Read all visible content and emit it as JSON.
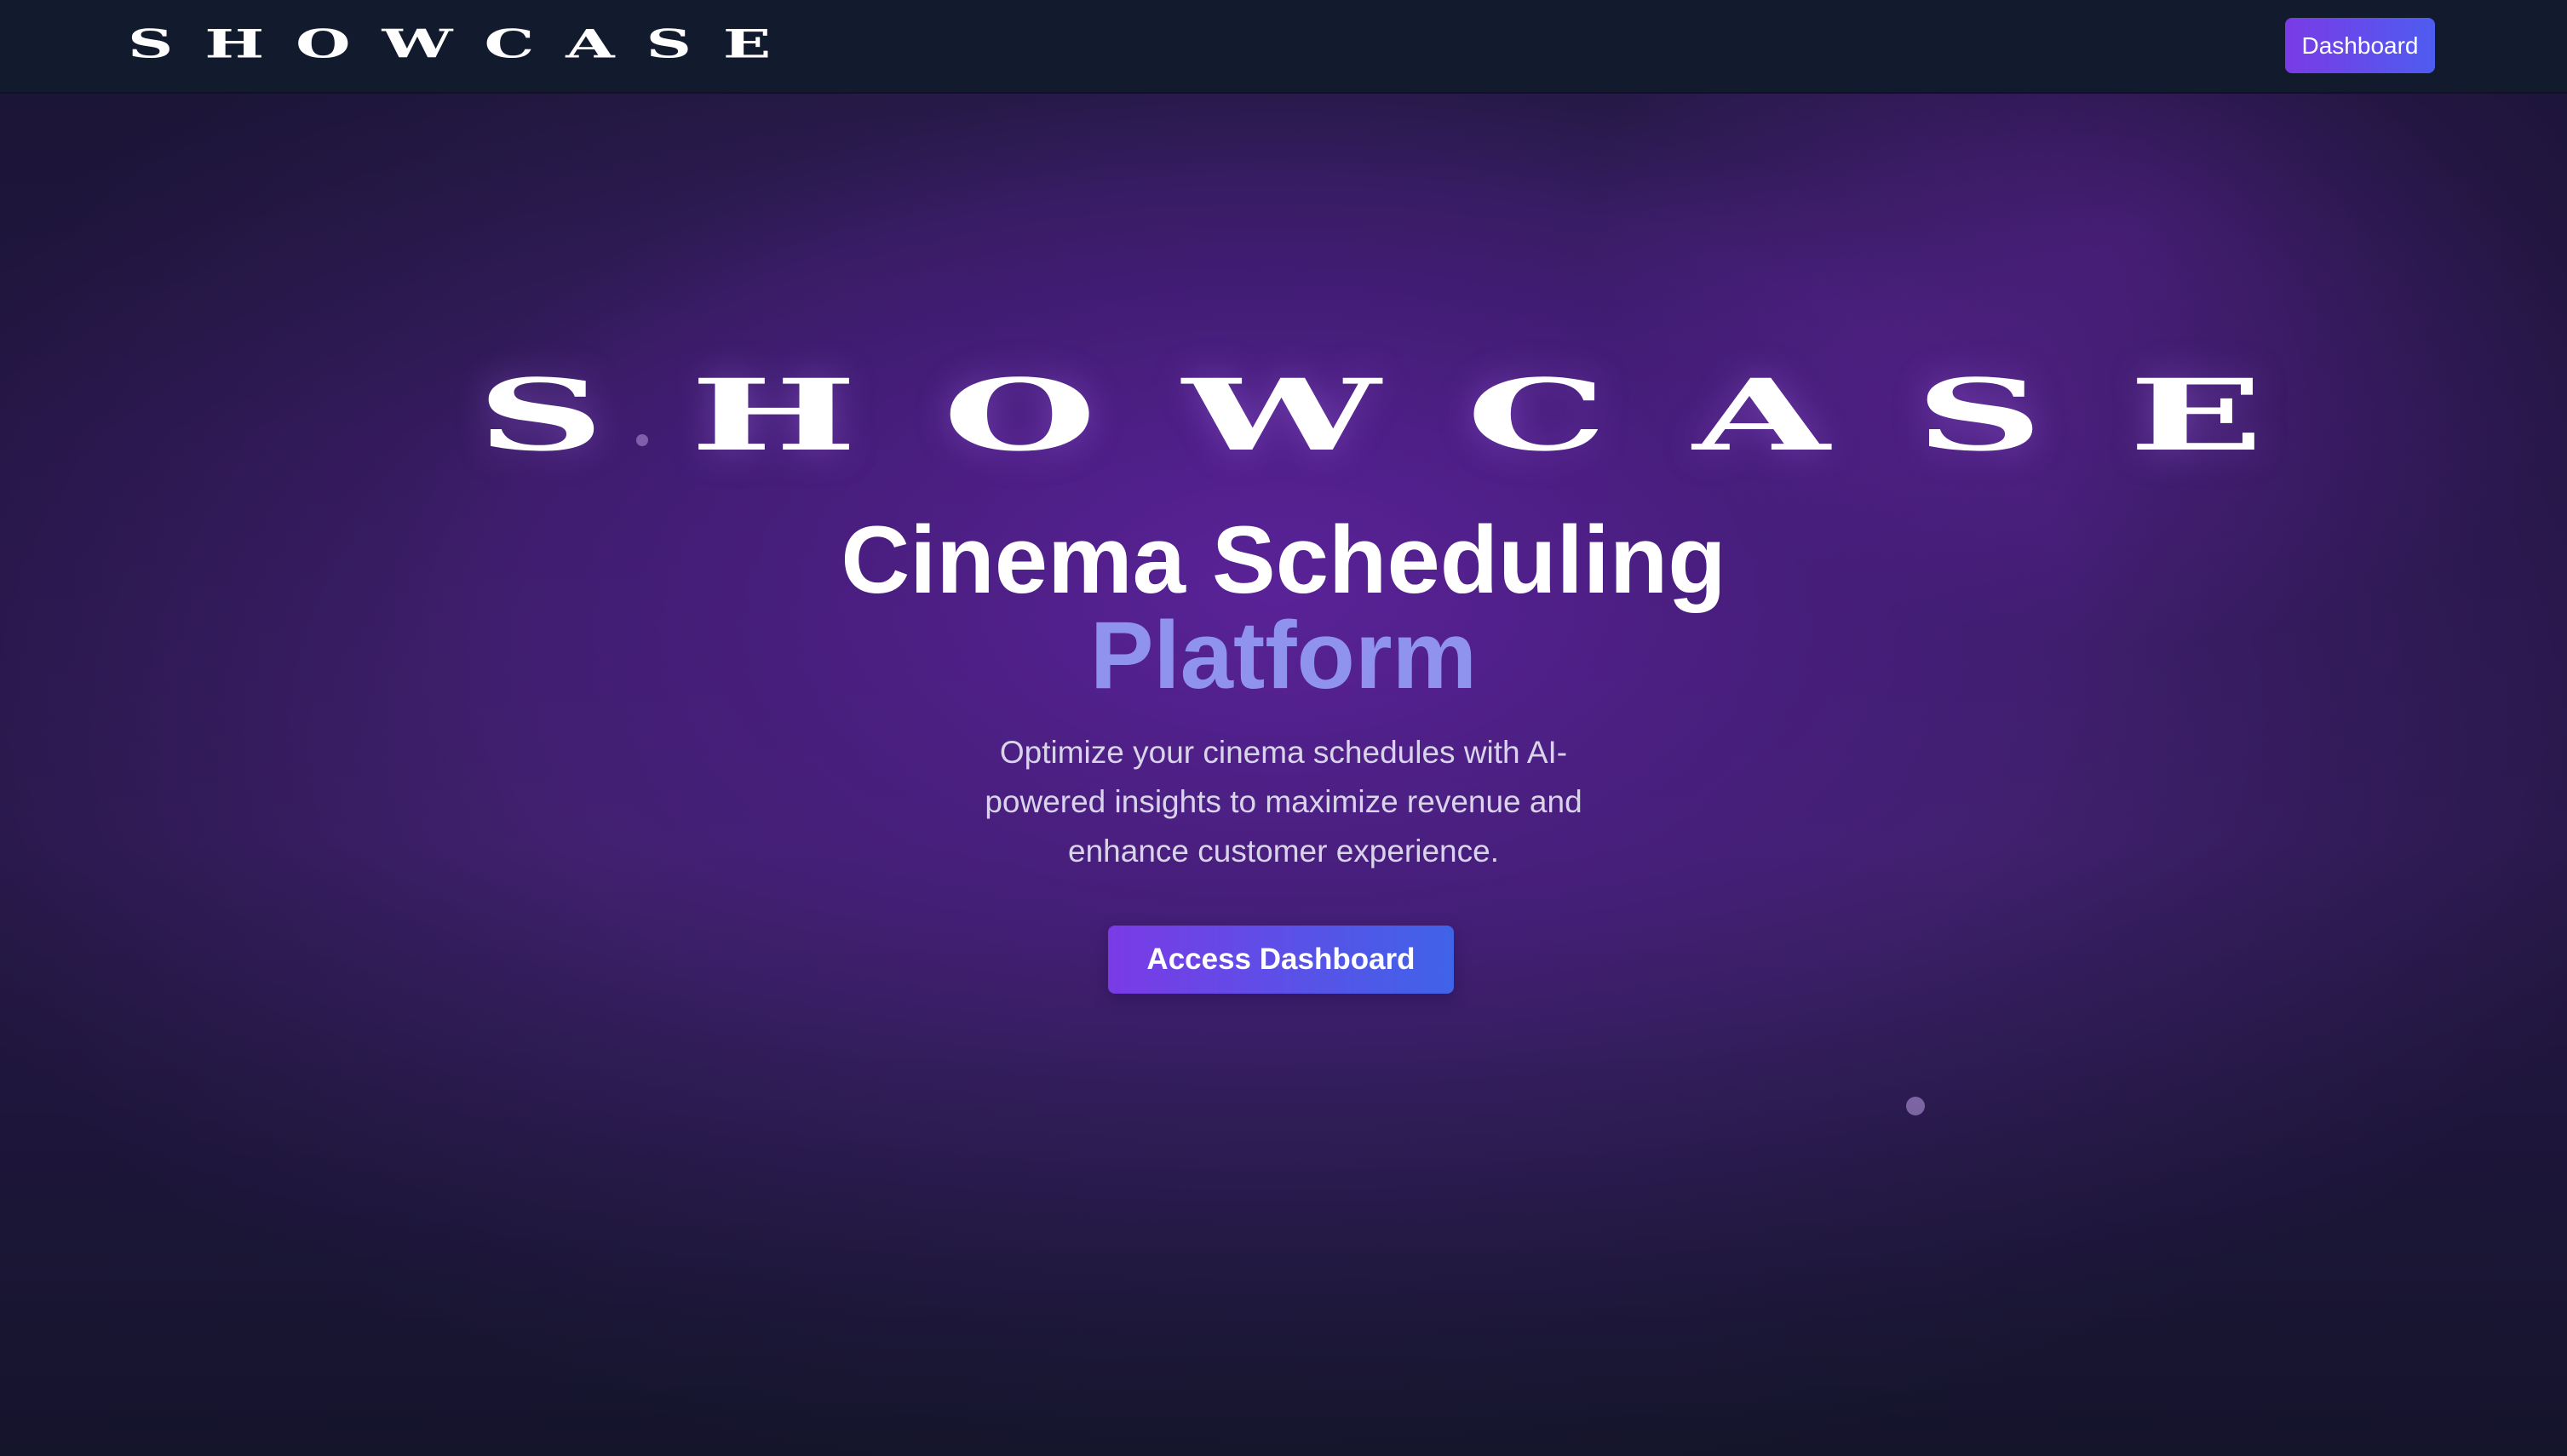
{
  "navbar": {
    "logo_text": "SHOWCASE",
    "dashboard_button_label": "Dashboard"
  },
  "hero": {
    "logo_text": "SHOWCASE",
    "title": "Cinema Scheduling",
    "title_accent": "Platform",
    "subtitle": "Optimize your cinema schedules with AI-powered insights to maximize revenue and enhance customer experience.",
    "cta_label": "Access Dashboard"
  },
  "colors": {
    "navbar_background": "#121a2e",
    "hero_background": "#3a1c66",
    "button_gradient_start": "#7a3be6",
    "button_gradient_end": "#4e5cf0",
    "title_accent": "#8f93ee",
    "subtitle_text": "#d9d4ea"
  }
}
